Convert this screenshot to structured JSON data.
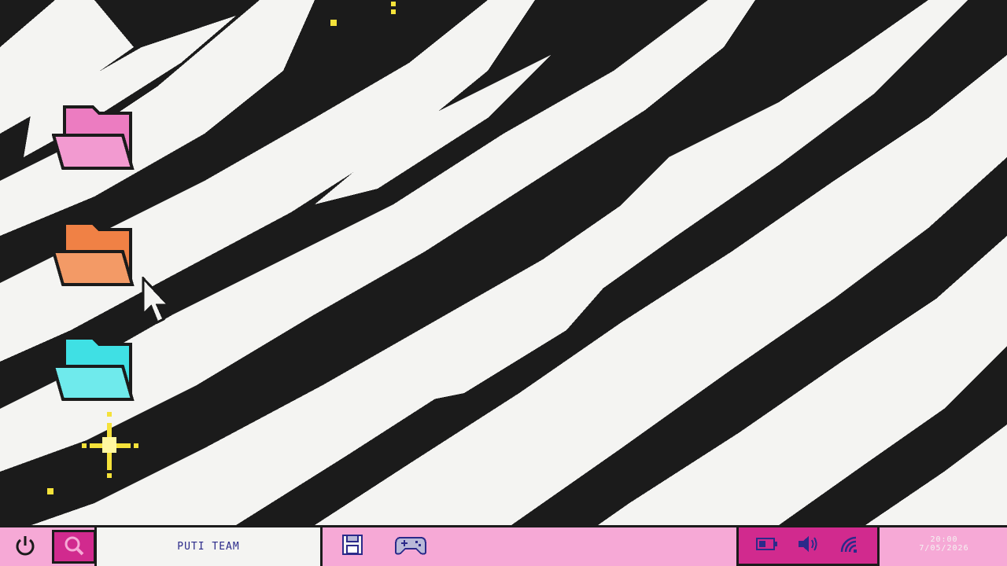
{
  "desktop": {
    "wallpaper": "zebra-stripes-pixel-art",
    "folders": [
      {
        "icon": "folder-icon",
        "color": "#ec7cc1"
      },
      {
        "icon": "folder-icon",
        "color": "#f08145"
      },
      {
        "icon": "folder-icon",
        "color": "#3fe0e4"
      }
    ],
    "cursor": "arrow-cursor-icon"
  },
  "taskbar": {
    "power_icon": "power-icon",
    "search_icon": "search-icon",
    "search_field_text": "PUTI TEAM",
    "apps": [
      {
        "icon": "floppy-disk-icon"
      },
      {
        "icon": "gamepad-icon"
      }
    ],
    "tray": [
      {
        "icon": "battery-icon"
      },
      {
        "icon": "volume-icon"
      },
      {
        "icon": "wifi-icon"
      }
    ],
    "clock": {
      "time": "20:00",
      "date": "7/05/2026"
    }
  },
  "colors": {
    "taskbar_bg": "#f6a9d6",
    "accent": "#d12a8e",
    "stripe_dark": "#1b1b1b",
    "stripe_light": "#f4f4f2",
    "sparkle": "#f5e23a",
    "text": "#2b2a8a"
  }
}
